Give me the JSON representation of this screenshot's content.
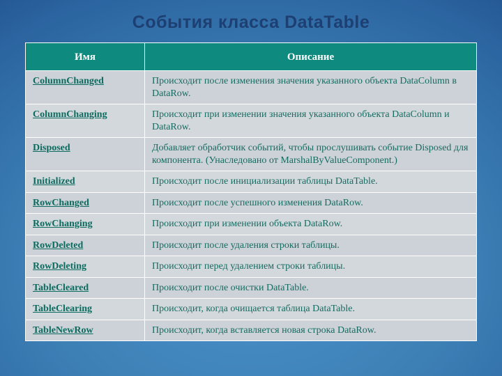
{
  "title": "События класса DataTable",
  "table": {
    "headers": {
      "name": "Имя",
      "desc": "Описание"
    },
    "rows": [
      {
        "name": "ColumnChanged",
        "desc": "Происходит после изменения значения указанного объекта DataColumn в DataRow."
      },
      {
        "name": "ColumnChanging",
        "desc": "Происходит при изменении значения указанного объекта DataColumn и DataRow."
      },
      {
        "name": "Disposed",
        "desc": "Добавляет обработчик событий, чтобы прослушивать событие Disposed для компонента. (Унаследовано от MarshalByValueComponent.)"
      },
      {
        "name": "Initialized",
        "desc": "Происходит после инициализации таблицы DataTable."
      },
      {
        "name": "RowChanged",
        "desc": "Происходит после успешного изменения DataRow."
      },
      {
        "name": "RowChanging",
        "desc": "Происходит при изменении объекта DataRow."
      },
      {
        "name": "RowDeleted",
        "desc": "Происходит после удаления строки таблицы."
      },
      {
        "name": "RowDeleting",
        "desc": "Происходит перед удалением строки таблицы."
      },
      {
        "name": "TableCleared",
        "desc": "Происходит после очистки DataTable."
      },
      {
        "name": "TableClearing",
        "desc": "Происходит, когда очищается таблица DataTable."
      },
      {
        "name": "TableNewRow",
        "desc": "Происходит, когда вставляется новая строка DataRow."
      }
    ]
  }
}
